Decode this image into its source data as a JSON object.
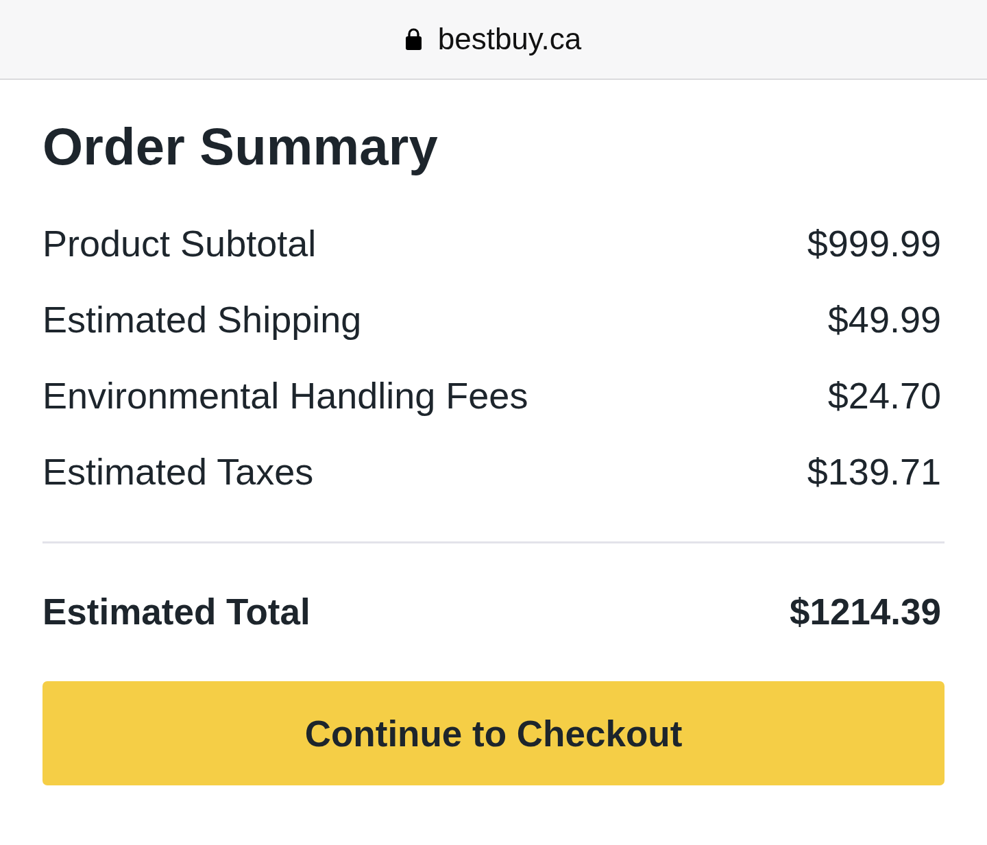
{
  "browser_bar": {
    "domain": "bestbuy.ca"
  },
  "title": "Order Summary",
  "line_items": [
    {
      "label": "Product Subtotal",
      "amount": "$999.99"
    },
    {
      "label": "Estimated Shipping",
      "amount": "$49.99"
    },
    {
      "label": "Environmental Handling Fees",
      "amount": "$24.70"
    },
    {
      "label": "Estimated Taxes",
      "amount": "$139.71"
    }
  ],
  "total": {
    "label": "Estimated Total",
    "amount": "$1214.39"
  },
  "checkout_button": {
    "label": "Continue to Checkout"
  }
}
